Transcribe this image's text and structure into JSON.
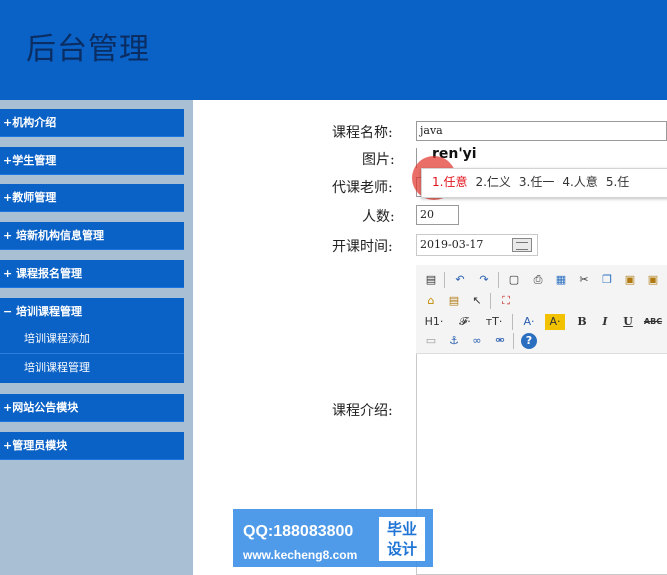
{
  "header": {
    "title": "后台管理"
  },
  "sidebar": {
    "items": [
      {
        "label": "+机构介绍"
      },
      {
        "label": "+学生管理"
      },
      {
        "label": "+教师管理"
      },
      {
        "label": "+ 培新机构信息管理"
      },
      {
        "label": "+ 课程报名管理"
      },
      {
        "label": "− 培训课程管理"
      },
      {
        "label": "+网站公告模块"
      },
      {
        "label": "+管理员模块"
      }
    ],
    "subitems": [
      {
        "label": "培训课程添加"
      },
      {
        "label": "培训课程管理"
      }
    ]
  },
  "form": {
    "course_name_label": "课程名称:",
    "course_name_value": "java",
    "image_label": "图片:",
    "teacher_label": "代课老师:",
    "count_label": "人数:",
    "count_value": "20",
    "start_time_label": "开课时间:",
    "start_time_value": "2019-03-17",
    "intro_label": "课程介绍:"
  },
  "ime": {
    "typed": "ren'yi",
    "candidates": [
      "1.任意",
      "2.仁义",
      "3.任一",
      "4.人意",
      "5.任"
    ]
  },
  "toolbar": {
    "row2_icons": [
      "paste-icon",
      "undo-icon",
      "redo-icon",
      "preview-icon",
      "print-icon",
      "template-icon",
      "cut-icon",
      "copy-icon",
      "paste-text-icon",
      "paste-word-icon"
    ],
    "row3_icons": [
      "broom-icon",
      "format-icon",
      "select-icon",
      "anchor-icon"
    ],
    "h1": "H1·",
    "font": "𝓕·",
    "size": "тT·",
    "fore_color": "A·",
    "back_color": "A·",
    "bold": "B",
    "italic": "I",
    "underline": "U",
    "strike": "ABC"
  },
  "watermark": {
    "qq": "QQ:188083800",
    "url": "www.kecheng8.com",
    "badge_line1": "毕业",
    "badge_line2": "设计"
  }
}
